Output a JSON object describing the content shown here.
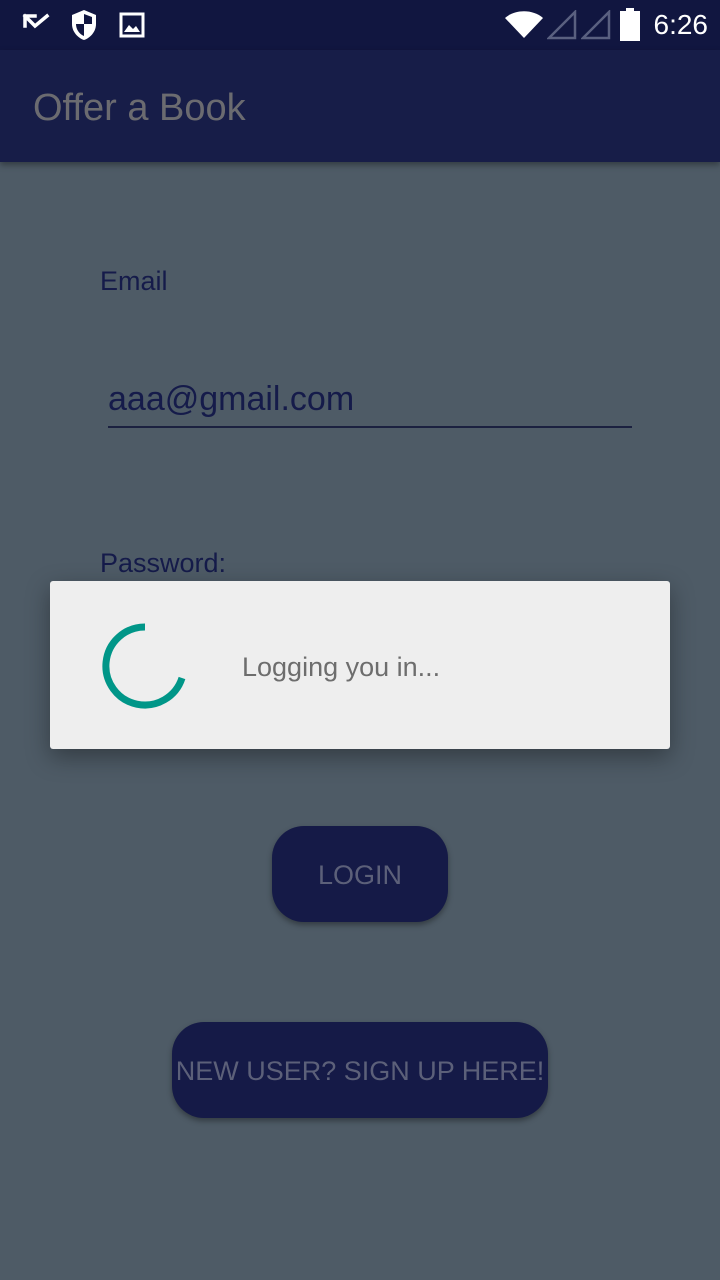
{
  "status_bar": {
    "time": "6:26",
    "icons": [
      "missed-call-arrow-icon",
      "shield-icon",
      "image-icon",
      "wifi-icon",
      "signal-empty-icon",
      "signal-empty-icon",
      "battery-icon"
    ]
  },
  "toolbar": {
    "title": "Offer a Book"
  },
  "form": {
    "email_label": "Email",
    "email_value": "aaa@gmail.com",
    "password_label": "Password:"
  },
  "buttons": {
    "login_label": "LOGIN",
    "signup_label": "NEW USER? SIGN UP HERE!"
  },
  "dialog": {
    "message": "Logging you in..."
  },
  "colors": {
    "status_bar": "#111640",
    "toolbar": "#171d48",
    "scrim_background": "#4e5b66",
    "spinner_accent": "#009688",
    "dialog_background": "#eeeeee"
  }
}
